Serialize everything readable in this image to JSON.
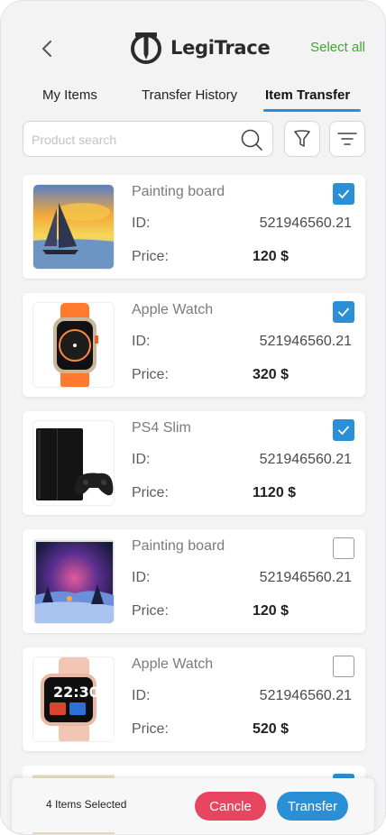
{
  "header": {
    "brand": "LegiTrace",
    "select_all": "Select all"
  },
  "tabs": [
    {
      "label": "My Items",
      "active": false
    },
    {
      "label": "Transfer History",
      "active": false
    },
    {
      "label": "Item Transfer",
      "active": true
    }
  ],
  "search": {
    "placeholder": "Product search",
    "value": ""
  },
  "items": [
    {
      "name": "Painting board",
      "id_label": "ID:",
      "id": "521946560.21",
      "price_label": "Price:",
      "price": "120 $",
      "checked": true,
      "image": "sailboat-painting"
    },
    {
      "name": "Apple Watch",
      "id_label": "ID:",
      "id": "521946560.21",
      "price_label": "Price:",
      "price": "320 $",
      "checked": true,
      "image": "orange-apple-watch"
    },
    {
      "name": "PS4 Slim",
      "id_label": "ID:",
      "id": "521946560.21",
      "price_label": "Price:",
      "price": "1120 $",
      "checked": true,
      "image": "ps4-console"
    },
    {
      "name": "Painting board",
      "id_label": "ID:",
      "id": "521946560.21",
      "price_label": "Price:",
      "price": "120 $",
      "checked": false,
      "image": "night-sky-painting"
    },
    {
      "name": "Apple Watch",
      "id_label": "ID:",
      "id": "521946560.21",
      "price_label": "Price:",
      "price": "520 $",
      "checked": false,
      "image": "pink-smart-watch"
    }
  ],
  "bottom_bar": {
    "selected_count": "4 Items Selected",
    "cancel_label": "Cancle",
    "transfer_label": "Transfer"
  },
  "colors": {
    "accent": "#2b8fd6",
    "select_all": "#3ea82f",
    "cancel": "#e84560"
  }
}
